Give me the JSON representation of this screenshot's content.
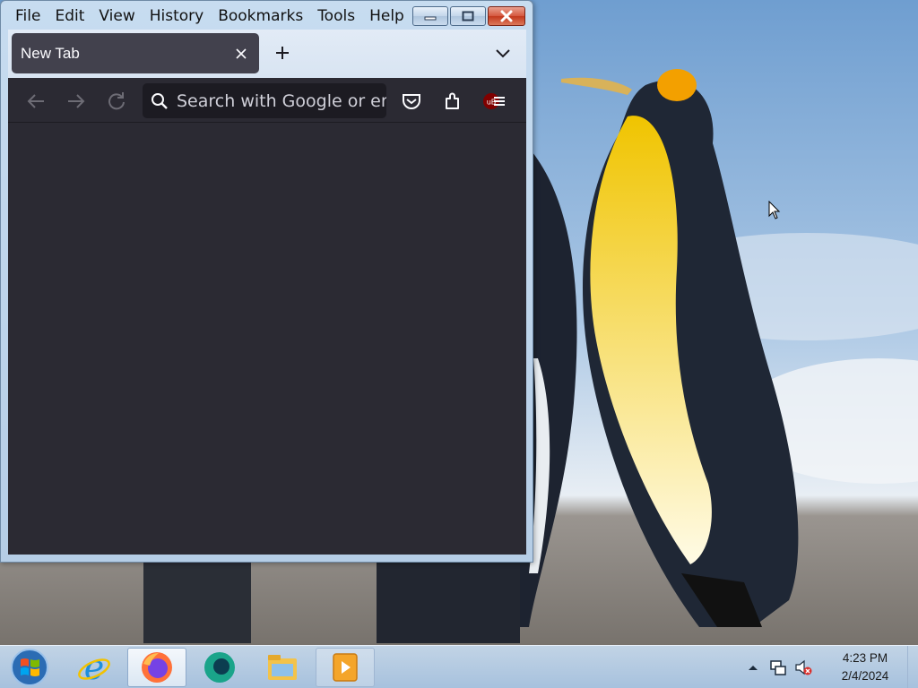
{
  "window": {
    "menu": [
      "File",
      "Edit",
      "View",
      "History",
      "Bookmarks",
      "Tools",
      "Help"
    ]
  },
  "browser": {
    "tab": {
      "title": "New Tab"
    },
    "urlbar": {
      "placeholder": "Search with Google or enter address",
      "value": ""
    }
  },
  "taskbar": {
    "apps": [
      "internet-explorer-icon",
      "firefox-icon",
      "chat-app-icon",
      "file-explorer-icon",
      "media-player-icon"
    ],
    "clock": {
      "time": "4:23 PM",
      "date": "2/4/2024"
    }
  },
  "colors": {
    "browser_bg": "#2b2a33",
    "tab_bg": "#42414d",
    "urlbar_bg": "#1c1b22",
    "text": "#fbfbfe",
    "close_button": "#c3381d"
  }
}
